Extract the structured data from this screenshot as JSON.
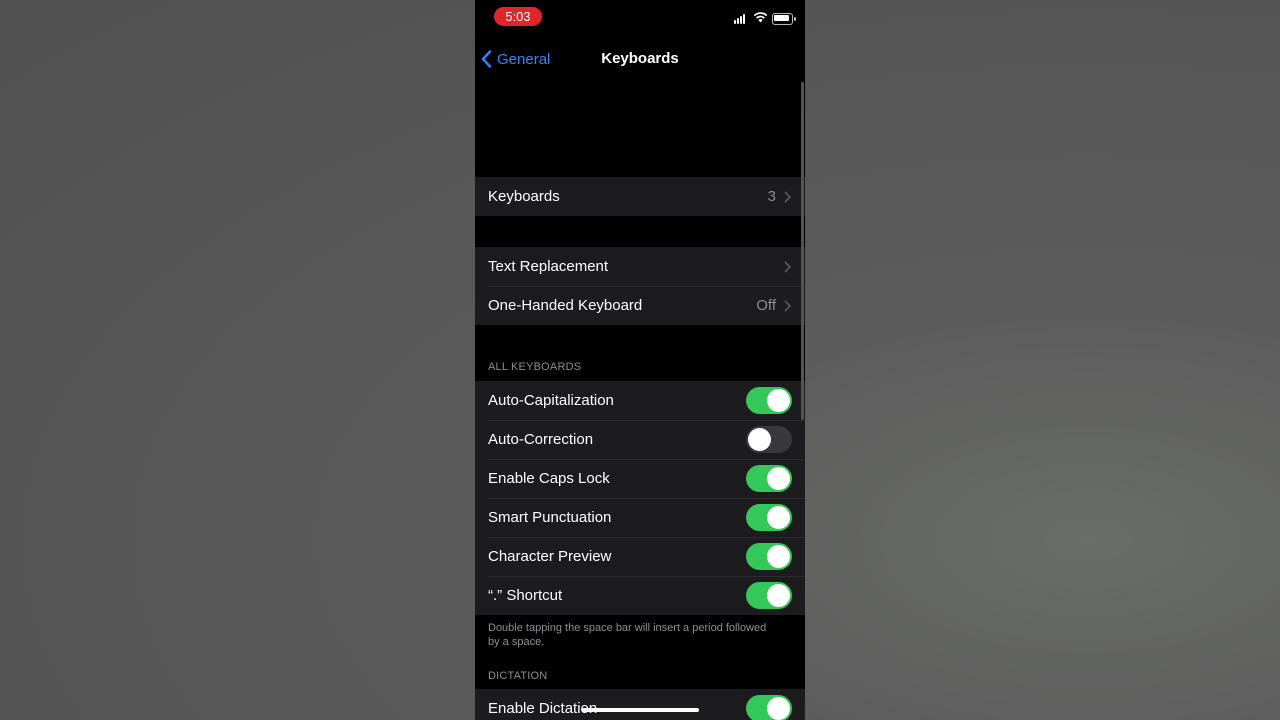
{
  "status": {
    "time": "5:03"
  },
  "nav": {
    "back_label": "General",
    "title": "Keyboards"
  },
  "sections": {
    "keyboards": {
      "label": "Keyboards",
      "value": "3"
    },
    "text_replacement": {
      "label": "Text Replacement"
    },
    "one_handed": {
      "label": "One-Handed Keyboard",
      "value": "Off"
    },
    "all_keyboards": {
      "header": "ALL KEYBOARDS",
      "items": [
        {
          "label": "Auto-Capitalization",
          "on": true
        },
        {
          "label": "Auto-Correction",
          "on": false
        },
        {
          "label": "Enable Caps Lock",
          "on": true
        },
        {
          "label": "Smart Punctuation",
          "on": true
        },
        {
          "label": "Character Preview",
          "on": true
        },
        {
          "label": "“.” Shortcut",
          "on": true
        }
      ],
      "footer": "Double tapping the space bar will insert a period followed by a space."
    },
    "dictation": {
      "header": "DICTATION",
      "items": [
        {
          "label": "Enable Dictation",
          "on": true
        }
      ]
    }
  },
  "colors": {
    "accent": "#2f86ff",
    "toggle_on": "#34c759",
    "time_pill": "#e0262a"
  }
}
